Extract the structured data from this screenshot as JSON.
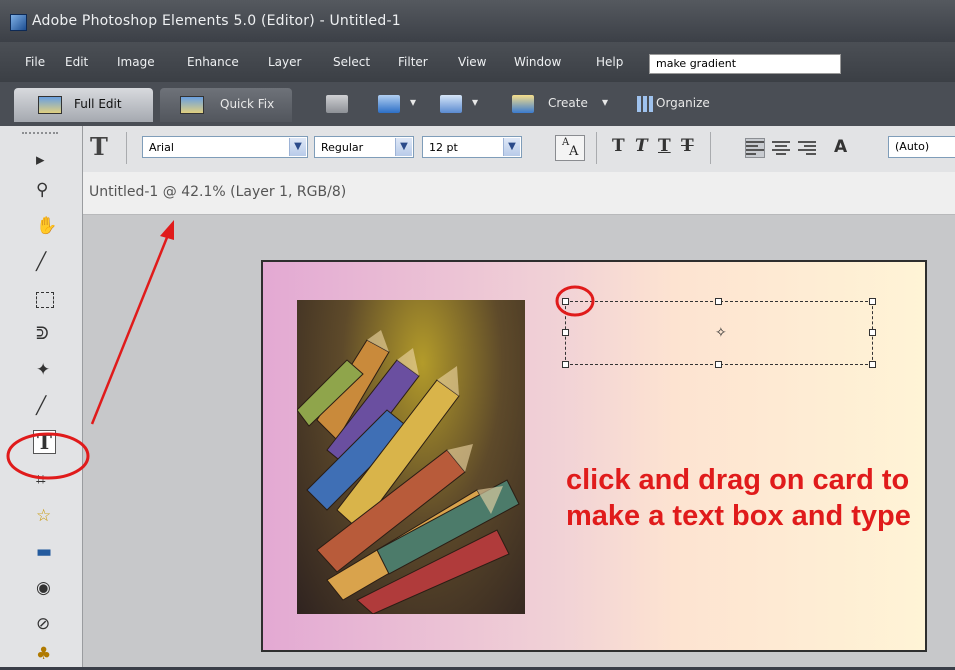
{
  "window": {
    "title": "Adobe Photoshop Elements 5.0 (Editor) - Untitled-1"
  },
  "menu": {
    "items": [
      "File",
      "Edit",
      "Image",
      "Enhance",
      "Layer",
      "Select",
      "Filter",
      "View",
      "Window",
      "Help"
    ],
    "search_value": "make gradient"
  },
  "shortcuts": {
    "tab_full_edit": "Full Edit",
    "tab_quick_fix": "Quick Fix",
    "create_label": "Create",
    "organize_label": "Organize"
  },
  "options": {
    "font_family": "Arial",
    "font_style": "Regular",
    "font_size": "12 pt",
    "leading": "(Auto)",
    "type_buttons": [
      "T",
      "T",
      "T",
      "T"
    ]
  },
  "document": {
    "title": "Untitled-1 @ 42.1% (Layer 1, RGB/8)",
    "instructions": "click and drag on card to make a text box and type"
  },
  "tools": [
    "move-tool",
    "zoom-tool",
    "hand-tool",
    "eyedropper-tool",
    "marquee-tool",
    "lasso-tool",
    "magic-wand-tool",
    "brush-tool",
    "type-tool",
    "crop-tool",
    "cookie-cutter-tool",
    "straighten-tool",
    "red-eye-tool",
    "healing-brush-tool",
    "clone-stamp-tool"
  ],
  "colors": {
    "annotation": "#e01b1b",
    "accent": "#2b5fa8"
  }
}
